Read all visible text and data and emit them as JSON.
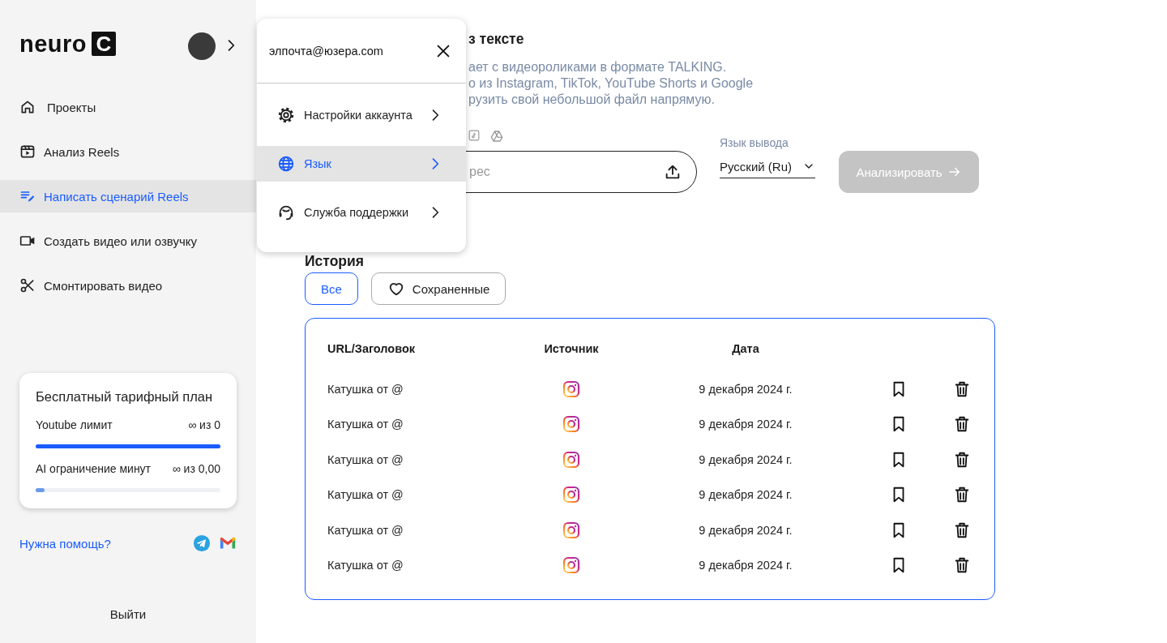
{
  "sidebar": {
    "logo": {
      "word": "neuro",
      "badge": "C"
    },
    "nav": [
      {
        "label": "Проекты",
        "selected": false
      },
      {
        "label": "Анализ Reels",
        "selected": false
      },
      {
        "label": "Написать сценарий Reels",
        "selected": true
      },
      {
        "label": "Создать видео или озвучку",
        "selected": false
      },
      {
        "label": "Смонтировать видео",
        "selected": false
      }
    ],
    "plan": {
      "title": "Бесплатный тарифный план",
      "limits": [
        {
          "label": "Youtube лимит",
          "value": "∞ из 0",
          "level": 1
        },
        {
          "label": "AI ограничение минут",
          "value": "∞ из 0,00",
          "level": 0.05
        }
      ]
    },
    "help": {
      "link": "Нужна помощь?"
    },
    "logout": "Выйти"
  },
  "account_menu": {
    "email": "элпочта@юзера.com",
    "items": [
      {
        "label": "Настройки аккаунта",
        "selected": false
      },
      {
        "label": "Язык",
        "selected": true
      },
      {
        "label": "Служба поддержки",
        "selected": false
      }
    ]
  },
  "main": {
    "title": "з тексте",
    "description": [
      "ает с видеороликами в формате TALKING.",
      "о из Instagram, TikTok, YouTube Shorts и Google",
      "рузить свой небольшой файл напрямую."
    ],
    "url_field": {
      "placeholder": "рес"
    },
    "output_language": {
      "label": "Язык вывода",
      "value": "Русский (Ru)"
    },
    "analyze_button": {
      "label": "Анализировать",
      "disabled": true
    }
  },
  "history": {
    "title": "История",
    "filters": [
      {
        "label": "Все",
        "selected": true
      },
      {
        "label": "Сохраненные",
        "selected": false
      }
    ],
    "table": {
      "columns": [
        "URL/Заголовок",
        "Источник",
        "Дата"
      ],
      "rows": [
        {
          "title": "Катушка от @",
          "date": "9 декабря 2024 г."
        },
        {
          "title": "Катушка от @",
          "date": "9 декабря 2024 г."
        },
        {
          "title": "Катушка от @",
          "date": "9 декабря 2024 г."
        },
        {
          "title": "Катушка от @",
          "date": "9 декабря 2024 г."
        },
        {
          "title": "Катушка от @",
          "date": "9 декабря 2024 г."
        },
        {
          "title": "Катушка от @",
          "date": "9 декабря 2024 г."
        }
      ]
    }
  }
}
